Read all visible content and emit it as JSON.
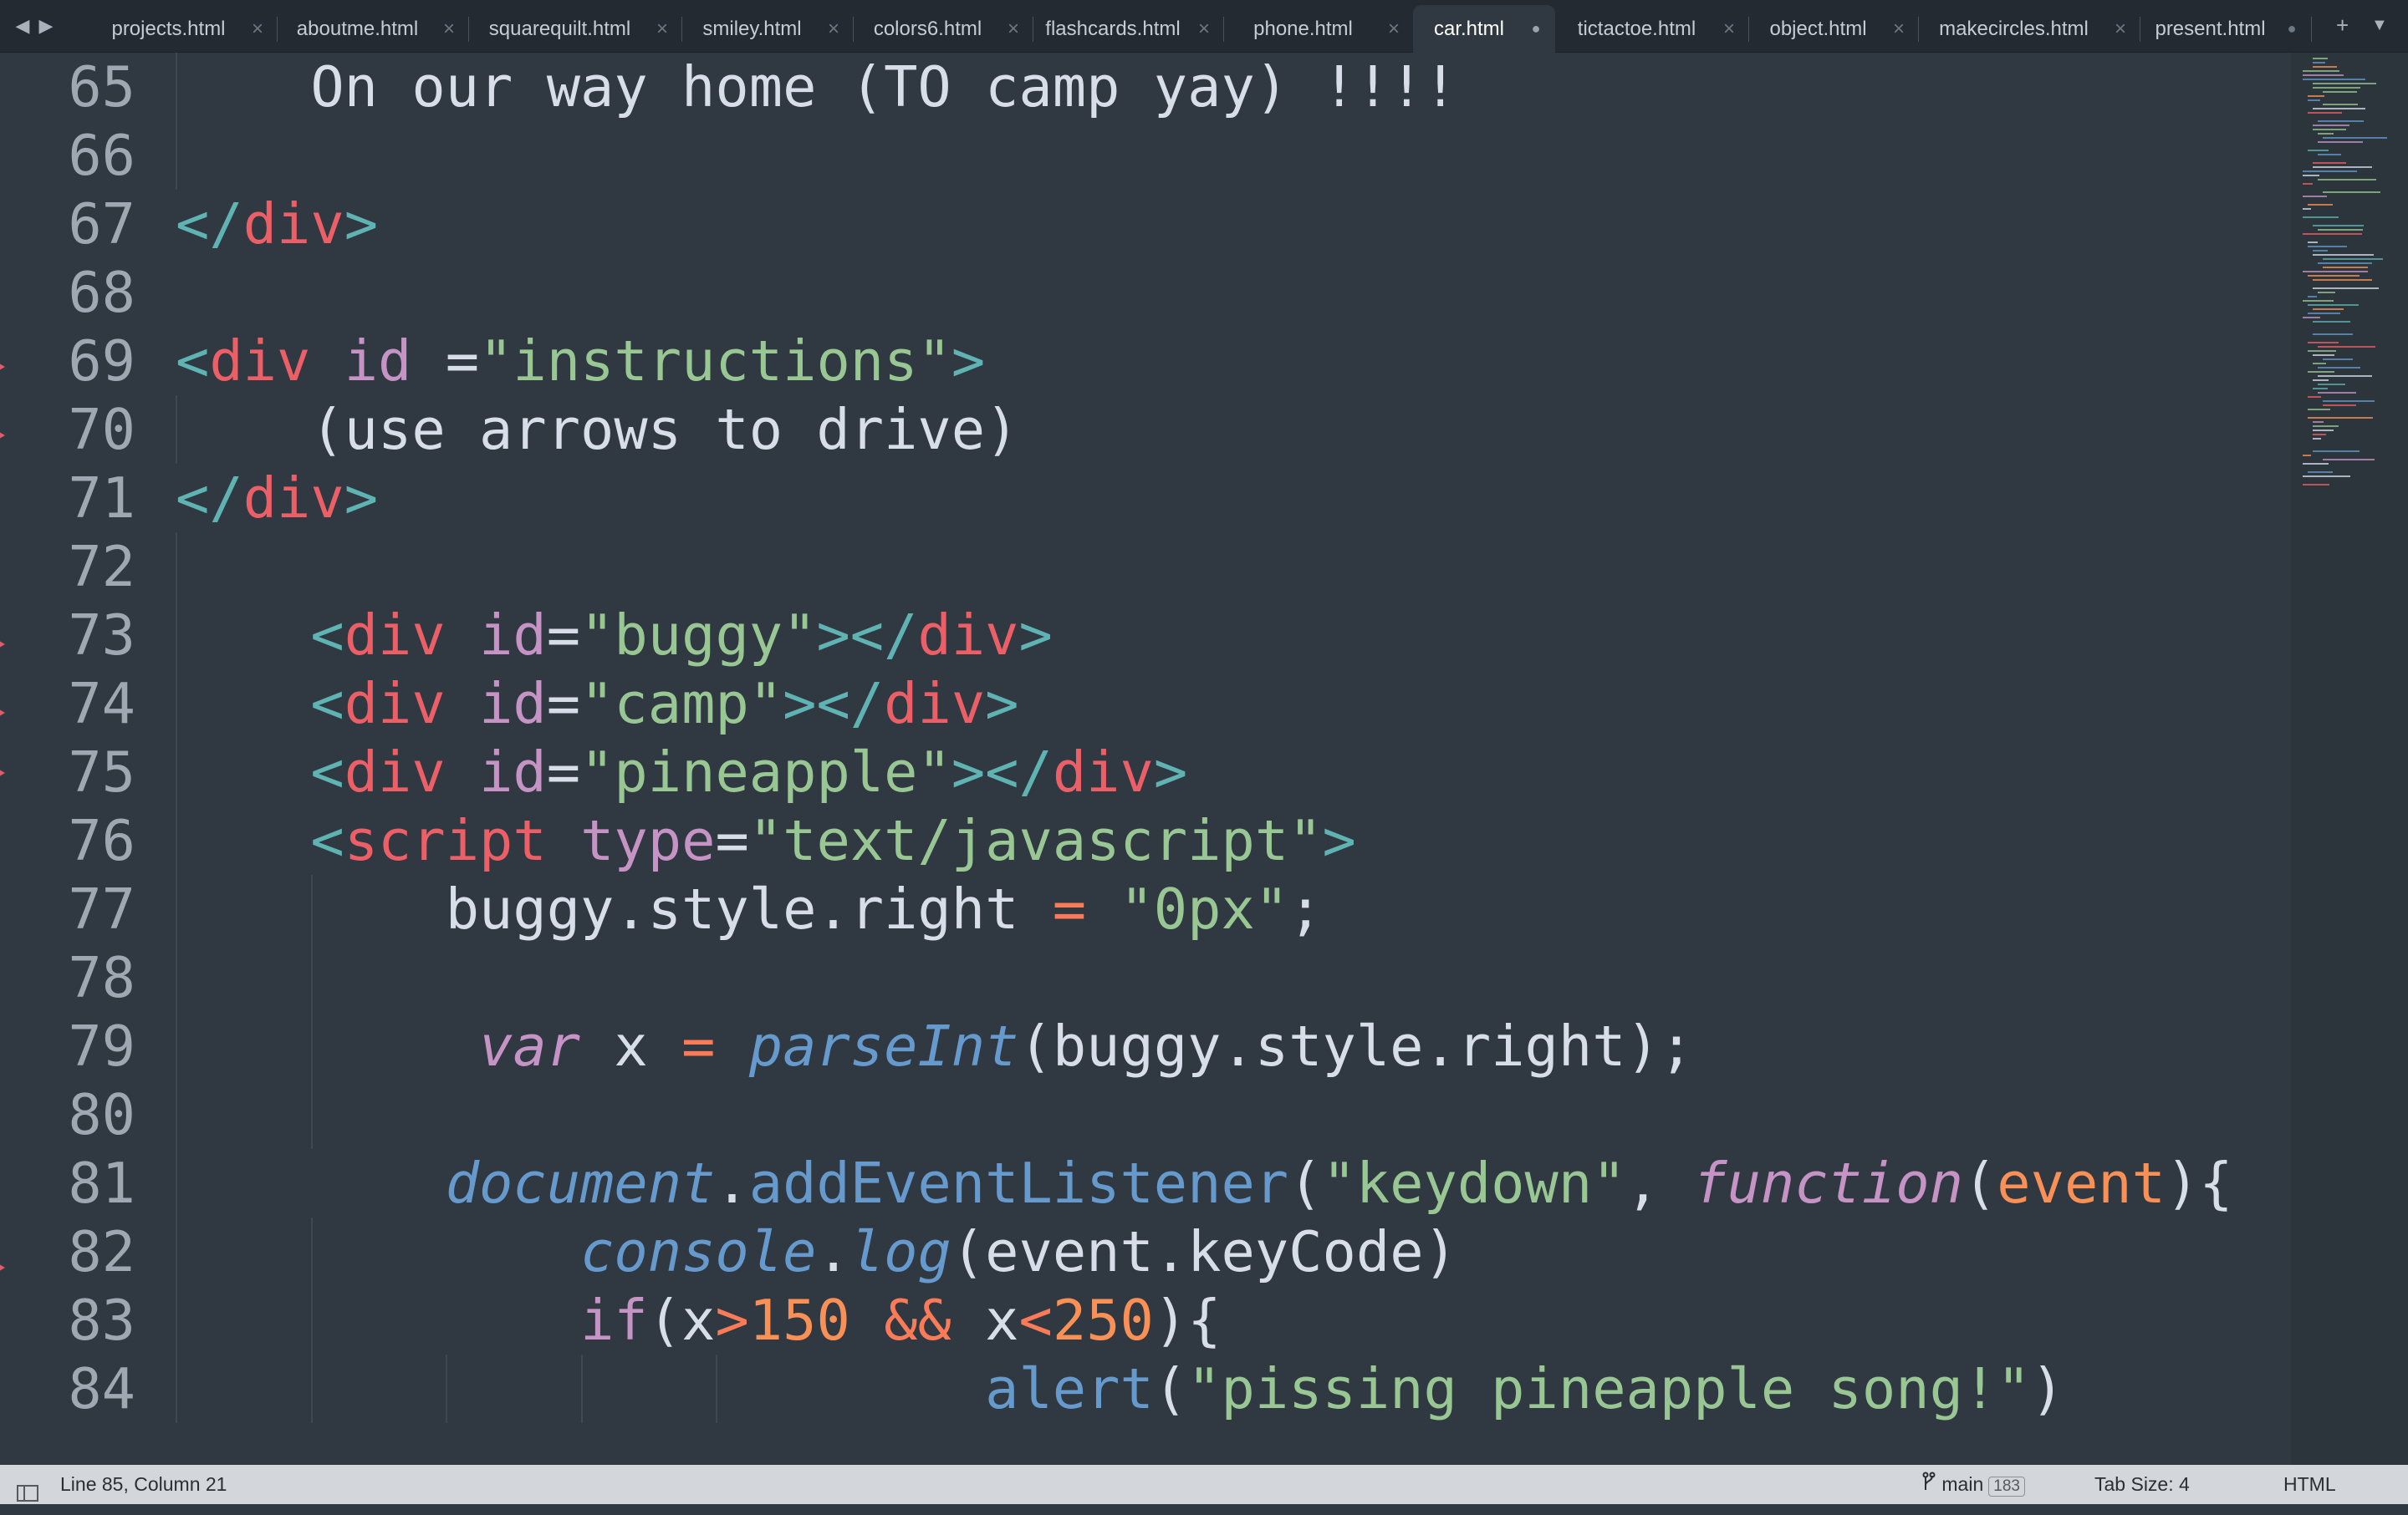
{
  "tabs": [
    {
      "label": "projects.html",
      "active": false,
      "modified": false
    },
    {
      "label": "aboutme.html",
      "active": false,
      "modified": false
    },
    {
      "label": "squarequilt.html",
      "active": false,
      "modified": false
    },
    {
      "label": "smiley.html",
      "active": false,
      "modified": false
    },
    {
      "label": "colors6.html",
      "active": false,
      "modified": false
    },
    {
      "label": "flashcards.html",
      "active": false,
      "modified": false
    },
    {
      "label": "phone.html",
      "active": false,
      "modified": false
    },
    {
      "label": "car.html",
      "active": true,
      "modified": true
    },
    {
      "label": "tictactoe.html",
      "active": false,
      "modified": false
    },
    {
      "label": "object.html",
      "active": false,
      "modified": false
    },
    {
      "label": "makecircles.html",
      "active": false,
      "modified": false
    },
    {
      "label": "present.html",
      "active": false,
      "modified": true
    }
  ],
  "icons": {
    "back": "◀",
    "forward": "▶",
    "close": "×",
    "modified": "●",
    "new_tab": "+",
    "tab_menu": "▼",
    "sidebar": "sidebar-icon",
    "branch": "git-branch-icon"
  },
  "editor": {
    "lines": [
      {
        "n": "65",
        "guides": [
          1
        ],
        "tokens": [
          [
            "txt",
            "    On our way home (TO camp yay) !!!!"
          ]
        ]
      },
      {
        "n": "66",
        "guides": [
          1
        ],
        "tokens": []
      },
      {
        "n": "67",
        "guides": [],
        "tokens": [
          [
            "tag",
            "</"
          ],
          [
            "name",
            "div"
          ],
          [
            "tag",
            ">"
          ]
        ]
      },
      {
        "n": "68",
        "guides": [],
        "tokens": []
      },
      {
        "n": "69",
        "guides": [],
        "tokens": [
          [
            "tag",
            "<"
          ],
          [
            "name",
            "div"
          ],
          [
            "txt",
            " "
          ],
          [
            "attr",
            "id"
          ],
          [
            "txt",
            " ="
          ],
          [
            "str",
            "\"instructions\""
          ],
          [
            "tag",
            ">"
          ]
        ]
      },
      {
        "n": "70",
        "guides": [
          1
        ],
        "tokens": [
          [
            "txt",
            "    (use arrows to drive)"
          ]
        ]
      },
      {
        "n": "71",
        "guides": [],
        "tokens": [
          [
            "tag",
            "</"
          ],
          [
            "name",
            "div"
          ],
          [
            "tag",
            ">"
          ]
        ]
      },
      {
        "n": "72",
        "guides": [
          1
        ],
        "tokens": []
      },
      {
        "n": "73",
        "guides": [
          1
        ],
        "tokens": [
          [
            "txt",
            "    "
          ],
          [
            "tag",
            "<"
          ],
          [
            "name",
            "div"
          ],
          [
            "txt",
            " "
          ],
          [
            "attr",
            "id"
          ],
          [
            "txt",
            "="
          ],
          [
            "str",
            "\"buggy\""
          ],
          [
            "tag",
            "></"
          ],
          [
            "name",
            "div"
          ],
          [
            "tag",
            ">"
          ]
        ]
      },
      {
        "n": "74",
        "guides": [
          1
        ],
        "tokens": [
          [
            "txt",
            "    "
          ],
          [
            "tag",
            "<"
          ],
          [
            "name",
            "div"
          ],
          [
            "txt",
            " "
          ],
          [
            "attr",
            "id"
          ],
          [
            "txt",
            "="
          ],
          [
            "str",
            "\"camp\""
          ],
          [
            "tag",
            "></"
          ],
          [
            "name",
            "div"
          ],
          [
            "tag",
            ">"
          ]
        ]
      },
      {
        "n": "75",
        "guides": [
          1
        ],
        "tokens": [
          [
            "txt",
            "    "
          ],
          [
            "tag",
            "<"
          ],
          [
            "name",
            "div"
          ],
          [
            "txt",
            " "
          ],
          [
            "attr",
            "id"
          ],
          [
            "txt",
            "="
          ],
          [
            "str",
            "\"pineapple\""
          ],
          [
            "tag",
            "></"
          ],
          [
            "name",
            "div"
          ],
          [
            "tag",
            ">"
          ]
        ]
      },
      {
        "n": "76",
        "guides": [
          1
        ],
        "tokens": [
          [
            "txt",
            "    "
          ],
          [
            "tag",
            "<"
          ],
          [
            "name",
            "script"
          ],
          [
            "txt",
            " "
          ],
          [
            "attr",
            "type"
          ],
          [
            "txt",
            "="
          ],
          [
            "str",
            "\"text/javascript\""
          ],
          [
            "tag",
            ">"
          ]
        ]
      },
      {
        "n": "77",
        "guides": [
          1,
          2
        ],
        "tokens": [
          [
            "txt",
            "        buggy.style.right "
          ],
          [
            "op",
            "="
          ],
          [
            "txt",
            " "
          ],
          [
            "str",
            "\"0px\""
          ],
          [
            "punc",
            ";"
          ]
        ]
      },
      {
        "n": "78",
        "guides": [
          1,
          2
        ],
        "tokens": []
      },
      {
        "n": "79",
        "guides": [
          1,
          2
        ],
        "tokens": [
          [
            "txt",
            "         "
          ],
          [
            "kw",
            "var"
          ],
          [
            "txt",
            " x "
          ],
          [
            "op",
            "="
          ],
          [
            "txt",
            " "
          ],
          [
            "fn",
            "parseInt"
          ],
          [
            "punc",
            "("
          ],
          [
            "txt",
            "buggy.style.right"
          ],
          [
            "punc",
            ");"
          ]
        ]
      },
      {
        "n": "80",
        "guides": [
          1,
          2
        ],
        "tokens": []
      },
      {
        "n": "81",
        "guides": [
          1
        ],
        "tokens": [
          [
            "txt",
            "        "
          ],
          [
            "fn",
            "document"
          ],
          [
            "punc",
            "."
          ],
          [
            "call",
            "addEventListener"
          ],
          [
            "punc",
            "("
          ],
          [
            "str",
            "\"keydown\""
          ],
          [
            "punc",
            ", "
          ],
          [
            "kw",
            "function"
          ],
          [
            "punc",
            "("
          ],
          [
            "param",
            "event"
          ],
          [
            "punc",
            "){"
          ]
        ]
      },
      {
        "n": "82",
        "guides": [
          1,
          2
        ],
        "tokens": [
          [
            "txt",
            "            "
          ],
          [
            "fn",
            "console"
          ],
          [
            "punc",
            "."
          ],
          [
            "fn",
            "log"
          ],
          [
            "punc",
            "("
          ],
          [
            "txt",
            "event.keyCode"
          ],
          [
            "punc",
            ")"
          ]
        ]
      },
      {
        "n": "83",
        "guides": [
          1,
          2
        ],
        "tokens": [
          [
            "txt",
            "            "
          ],
          [
            "ctrl",
            "if"
          ],
          [
            "punc",
            "("
          ],
          [
            "txt",
            "x"
          ],
          [
            "op",
            ">"
          ],
          [
            "num",
            "150"
          ],
          [
            "txt",
            " "
          ],
          [
            "op",
            "&&"
          ],
          [
            "txt",
            " x"
          ],
          [
            "op",
            "<"
          ],
          [
            "num",
            "250"
          ],
          [
            "punc",
            "){"
          ]
        ]
      },
      {
        "n": "84",
        "guides": [
          1,
          2,
          3,
          4,
          5
        ],
        "tokens": [
          [
            "txt",
            "                        "
          ],
          [
            "call",
            "alert"
          ],
          [
            "punc",
            "("
          ],
          [
            "str",
            "\"pissing pineapple song!\""
          ],
          [
            "punc",
            ")"
          ]
        ]
      }
    ]
  },
  "status": {
    "position": "Line 85, Column 21",
    "branch": "main",
    "branch_count": "183",
    "tab_size": "Tab Size: 4",
    "syntax": "HTML"
  }
}
